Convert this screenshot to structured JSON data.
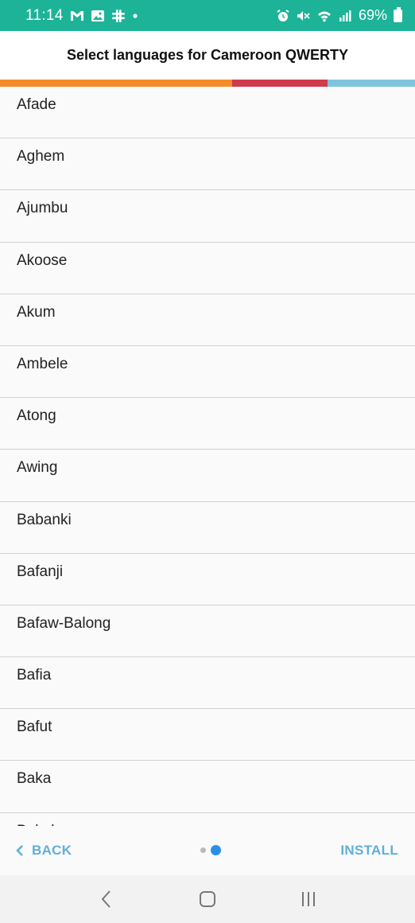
{
  "status_bar": {
    "time": "11:14",
    "battery_text": "69%",
    "left_icons": [
      "gmail-icon",
      "gallery-icon",
      "slack-icon",
      "dot-icon"
    ],
    "right_icons": [
      "alarm-icon",
      "mute-icon",
      "wifi-icon",
      "signal-icon",
      "battery-icon"
    ]
  },
  "header": {
    "title": "Select languages for Cameroon QWERTY"
  },
  "progress_colors": [
    "#f68b29",
    "#cf3a4c",
    "#7fc4de"
  ],
  "progress_fractions": [
    0.56,
    0.23,
    0.21
  ],
  "languages": [
    "Afade",
    "Aghem",
    "Ajumbu",
    "Akoose",
    "Akum",
    "Ambele",
    "Atong",
    "Awing",
    "Babanki",
    "Bafanji",
    "Bafaw-Balong",
    "Bafia",
    "Bafut",
    "Baka",
    "Bakoko"
  ],
  "footer": {
    "back_label": "BACK",
    "install_label": "INSTALL",
    "page_indicator": {
      "total": 2,
      "current": 2
    }
  },
  "colors": {
    "status_bar": "#1db399",
    "accent": "#5fb0d6",
    "active_dot": "#2b8fe5"
  }
}
